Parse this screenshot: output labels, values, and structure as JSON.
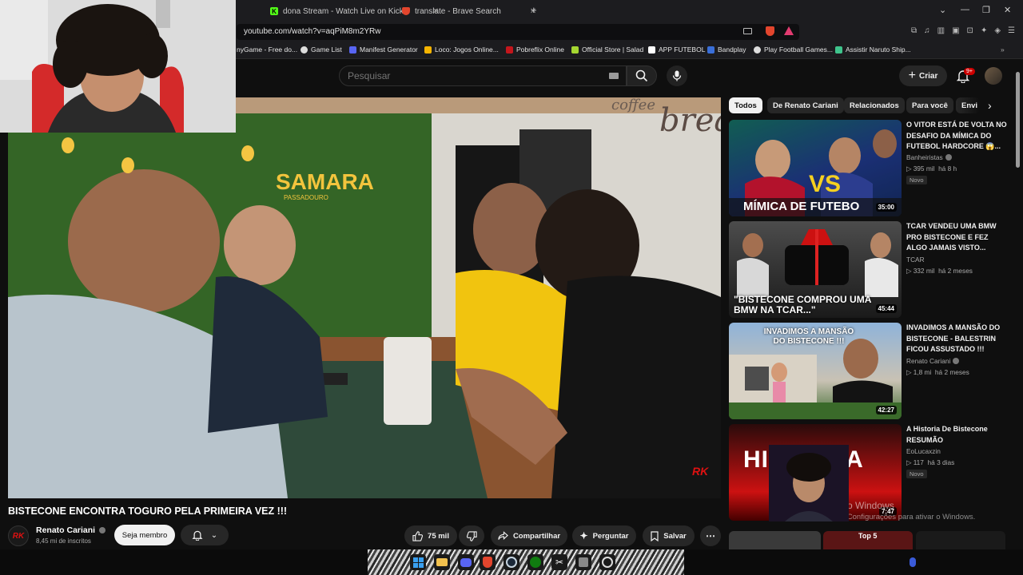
{
  "browser": {
    "tabs": [
      {
        "label": "dona Stream - Watch Live on Kick"
      },
      {
        "label": "translate - Brave Search"
      }
    ],
    "url": "youtube.com/watch?v=aqPiM8m2YRw",
    "bookmarks": [
      "nyGame - Free do...",
      "Game List",
      "Manifest Generator",
      "Loco: Jogos Online...",
      "Pobreflix Online",
      "Official Store | Salad",
      "APP FUTEBOL",
      "Bandplay",
      "Play Football Games...",
      "Assistir Naruto Ship..."
    ]
  },
  "header": {
    "search_placeholder": "Pesquisar",
    "create_label": "Criar",
    "notifications_badge": "9+"
  },
  "video": {
    "title": "BISTECONE ENCONTRA TOGURO PELA PRIMEIRA VEZ !!!",
    "sign_text": "SAMARA",
    "sign_sub": "PASSADOURO",
    "wall_text": "break",
    "wall_text2": "coffee",
    "channel": {
      "avatar_text": "RK",
      "name": "Renato Cariani",
      "subscribers": "8,45 mi de inscritos",
      "join_label": "Seja membro"
    },
    "actions": {
      "likes": "75 mil",
      "share": "Compartilhar",
      "ask": "Perguntar",
      "save": "Salvar"
    }
  },
  "chips": [
    "Todos",
    "De Renato Cariani",
    "Relacionados",
    "Para você",
    "Envi"
  ],
  "recommendations": [
    {
      "title": "O VITOR ESTÁ DE VOLTA NO DESAFIO DA MÍMICA DO FUTEBOL HARDCORE 😱...",
      "channel": "Banheiristas",
      "verified": true,
      "views": "395 mil",
      "age": "há 8 h",
      "badge": "Novo",
      "duration": "35:00",
      "caption": "MÍMICA DE FUTEBO"
    },
    {
      "title": "TCAR VENDEU UMA BMW PRO BISTECONE E FEZ ALGO JAMAIS VISTO...",
      "channel": "TCAR",
      "verified": false,
      "views": "332 mil",
      "age": "há 2 meses",
      "badge": "",
      "duration": "45:44",
      "caption": "\"BISTECONE COMPROU UMA BMW NA TCAR...\""
    },
    {
      "title": "INVADIMOS A MANSÃO DO BISTECONE - BALESTRIN FICOU ASSUSTADO !!!",
      "channel": "Renato Cariani",
      "verified": true,
      "views": "1,8 mi",
      "age": "há 2 meses",
      "badge": "",
      "duration": "42:27",
      "caption": "INVADIMOS A MANSÃO DO BISTECONE !!!"
    },
    {
      "title": "A Historia De Bistecone RESUMÃO",
      "channel": "EoLucaxzin",
      "verified": false,
      "views": "117",
      "age": "há 3 dias",
      "badge": "Novo",
      "duration": "7:47",
      "caption": "HISTORIA"
    }
  ],
  "next_thumb_caption": "Top 5",
  "windows_watermark": {
    "line1": "Ativar o Windows",
    "line2": "Acesse Configurações para ativar o Windows."
  },
  "colors": {
    "accent_red": "#cc0000",
    "background": "#0f0f0f",
    "kick_green": "#53fc18"
  }
}
